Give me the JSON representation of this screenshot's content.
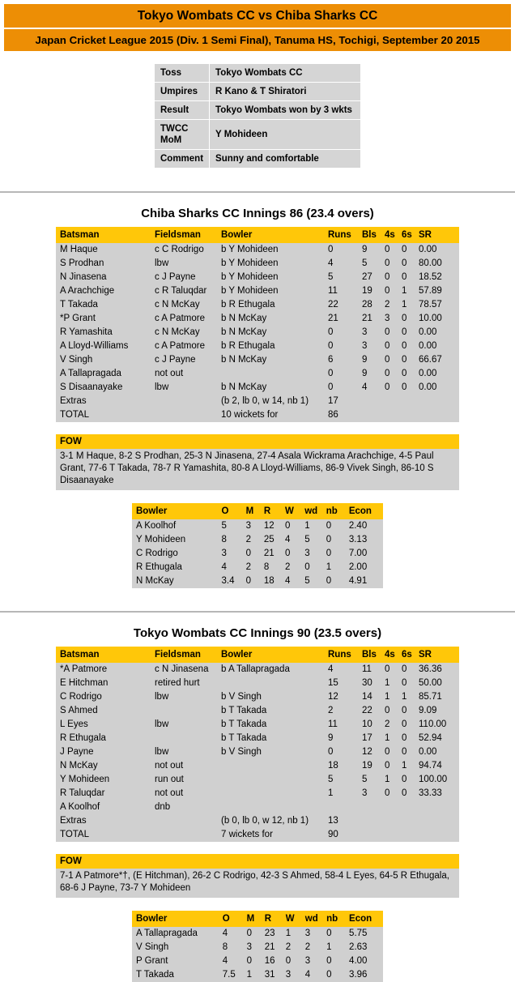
{
  "header": {
    "title": "Tokyo Wombats CC vs Chiba Sharks CC",
    "subtitle": "Japan Cricket League 2015 (Div. 1 Semi Final), Tanuma HS, Tochigi, September 20 2015",
    "colors": {
      "banner_bg": "#ED8E05",
      "table_header": "#FFC709",
      "row_bg": "#d0d0d0"
    }
  },
  "match_info": {
    "rows": [
      {
        "label": "Toss",
        "value": "Tokyo Wombats CC"
      },
      {
        "label": "Umpires",
        "value": "R Kano & T Shiratori"
      },
      {
        "label": "Result",
        "value": "Tokyo Wombats won by 3 wkts"
      },
      {
        "label": "TWCC MoM",
        "value": "Y Mohideen"
      },
      {
        "label": "Comment",
        "value": "Sunny and comfortable"
      }
    ]
  },
  "innings": [
    {
      "title": "Chiba Sharks CC Innings 86 (23.4 overs)",
      "batting_headers": [
        "Batsman",
        "Fieldsman",
        "Bowler",
        "Runs",
        "Bls",
        "4s",
        "6s",
        "SR"
      ],
      "batting_rows": [
        {
          "batsman": "M Haque",
          "fieldsman": "c C Rodrigo",
          "bowler": "b Y Mohideen",
          "runs": "0",
          "bls": "9",
          "fours": "0",
          "sixes": "0",
          "sr": "0.00"
        },
        {
          "batsman": "S Prodhan",
          "fieldsman": "lbw",
          "bowler": "b Y Mohideen",
          "runs": "4",
          "bls": "5",
          "fours": "0",
          "sixes": "0",
          "sr": "80.00"
        },
        {
          "batsman": "N Jinasena",
          "fieldsman": "c J Payne",
          "bowler": "b Y Mohideen",
          "runs": "5",
          "bls": "27",
          "fours": "0",
          "sixes": "0",
          "sr": "18.52"
        },
        {
          "batsman": "A Arachchige",
          "fieldsman": "c R Taluqdar",
          "bowler": "b Y Mohideen",
          "runs": "11",
          "bls": "19",
          "fours": "0",
          "sixes": "1",
          "sr": "57.89"
        },
        {
          "batsman": "T Takada",
          "fieldsman": "c N McKay",
          "bowler": "b R Ethugala",
          "runs": "22",
          "bls": "28",
          "fours": "2",
          "sixes": "1",
          "sr": "78.57"
        },
        {
          "batsman": "*P Grant",
          "fieldsman": "c A Patmore",
          "bowler": "b N McKay",
          "runs": "21",
          "bls": "21",
          "fours": "3",
          "sixes": "0",
          "sr": "10.00"
        },
        {
          "batsman": "R Yamashita",
          "fieldsman": "c N McKay",
          "bowler": "b N McKay",
          "runs": "0",
          "bls": "3",
          "fours": "0",
          "sixes": "0",
          "sr": "0.00"
        },
        {
          "batsman": "A Lloyd-Williams",
          "fieldsman": "c A Patmore",
          "bowler": "b R Ethugala",
          "runs": "0",
          "bls": "3",
          "fours": "0",
          "sixes": "0",
          "sr": "0.00"
        },
        {
          "batsman": "V Singh",
          "fieldsman": "c J Payne",
          "bowler": "b N McKay",
          "runs": "6",
          "bls": "9",
          "fours": "0",
          "sixes": "0",
          "sr": "66.67"
        },
        {
          "batsman": "A Tallapragada",
          "fieldsman": "not out",
          "bowler": "",
          "runs": "0",
          "bls": "9",
          "fours": "0",
          "sixes": "0",
          "sr": "0.00"
        },
        {
          "batsman": "S Disaanayake",
          "fieldsman": "lbw",
          "bowler": "b N McKay",
          "runs": "0",
          "bls": "4",
          "fours": "0",
          "sixes": "0",
          "sr": "0.00"
        },
        {
          "batsman": "Extras",
          "fieldsman": "",
          "bowler": "(b 2, lb 0, w 14, nb 1)",
          "runs": "17",
          "bls": "",
          "fours": "",
          "sixes": "",
          "sr": ""
        },
        {
          "batsman": "TOTAL",
          "fieldsman": "",
          "bowler": "10 wickets for",
          "runs": "86",
          "bls": "",
          "fours": "",
          "sixes": "",
          "sr": ""
        }
      ],
      "fow_label": "FOW",
      "fow_text": "3-1 M Haque, 8-2 S Prodhan, 25-3 N Jinasena, 27-4 Asala Wickrama Arachchige, 4-5 Paul Grant, 77-6 T Takada, 78-7 R Yamashita, 80-8 A Lloyd-Williams, 86-9 Vivek Singh, 86-10 S Disaanayake",
      "bowling_headers": [
        "Bowler",
        "O",
        "M",
        "R",
        "W",
        "wd",
        "nb",
        "Econ"
      ],
      "bowling_rows": [
        {
          "bowler": "A Koolhof",
          "o": "5",
          "m": "3",
          "r": "12",
          "w": "0",
          "wd": "1",
          "nb": "0",
          "econ": "2.40"
        },
        {
          "bowler": "Y Mohideen",
          "o": "8",
          "m": "2",
          "r": "25",
          "w": "4",
          "wd": "5",
          "nb": "0",
          "econ": "3.13"
        },
        {
          "bowler": "C Rodrigo",
          "o": "3",
          "m": "0",
          "r": "21",
          "w": "0",
          "wd": "3",
          "nb": "0",
          "econ": "7.00"
        },
        {
          "bowler": "R Ethugala",
          "o": "4",
          "m": "2",
          "r": "8",
          "w": "2",
          "wd": "0",
          "nb": "1",
          "econ": "2.00"
        },
        {
          "bowler": "N McKay",
          "o": "3.4",
          "m": "0",
          "r": "18",
          "w": "4",
          "wd": "5",
          "nb": "0",
          "econ": "4.91"
        }
      ]
    },
    {
      "title": "Tokyo Wombats CC Innings 90 (23.5 overs)",
      "batting_headers": [
        "Batsman",
        "Fieldsman",
        "Bowler",
        "Runs",
        "Bls",
        "4s",
        "6s",
        "SR"
      ],
      "batting_rows": [
        {
          "batsman": "*A Patmore",
          "fieldsman": "c N Jinasena",
          "bowler": "b A Tallapragada",
          "runs": "4",
          "bls": "11",
          "fours": "0",
          "sixes": "0",
          "sr": "36.36"
        },
        {
          "batsman": "E Hitchman",
          "fieldsman": "retired hurt",
          "bowler": "",
          "runs": "15",
          "bls": "30",
          "fours": "1",
          "sixes": "0",
          "sr": "50.00"
        },
        {
          "batsman": "C Rodrigo",
          "fieldsman": "lbw",
          "bowler": "b V Singh",
          "runs": "12",
          "bls": "14",
          "fours": "1",
          "sixes": "1",
          "sr": "85.71"
        },
        {
          "batsman": "S Ahmed",
          "fieldsman": "",
          "bowler": "b T Takada",
          "runs": "2",
          "bls": "22",
          "fours": "0",
          "sixes": "0",
          "sr": "9.09"
        },
        {
          "batsman": "L Eyes",
          "fieldsman": "lbw",
          "bowler": "b T Takada",
          "runs": "11",
          "bls": "10",
          "fours": "2",
          "sixes": "0",
          "sr": "110.00"
        },
        {
          "batsman": "R Ethugala",
          "fieldsman": "",
          "bowler": "b T Takada",
          "runs": "9",
          "bls": "17",
          "fours": "1",
          "sixes": "0",
          "sr": "52.94"
        },
        {
          "batsman": "J Payne",
          "fieldsman": "lbw",
          "bowler": "b V Singh",
          "runs": "0",
          "bls": "12",
          "fours": "0",
          "sixes": "0",
          "sr": "0.00"
        },
        {
          "batsman": "N McKay",
          "fieldsman": "not out",
          "bowler": "",
          "runs": "18",
          "bls": "19",
          "fours": "0",
          "sixes": "1",
          "sr": "94.74"
        },
        {
          "batsman": "Y Mohideen",
          "fieldsman": "run out",
          "bowler": "",
          "runs": "5",
          "bls": "5",
          "fours": "1",
          "sixes": "0",
          "sr": "100.00"
        },
        {
          "batsman": "R Taluqdar",
          "fieldsman": "not out",
          "bowler": "",
          "runs": "1",
          "bls": "3",
          "fours": "0",
          "sixes": "0",
          "sr": "33.33"
        },
        {
          "batsman": "A Koolhof",
          "fieldsman": "dnb",
          "bowler": "",
          "runs": "",
          "bls": "",
          "fours": "",
          "sixes": "",
          "sr": ""
        },
        {
          "batsman": "Extras",
          "fieldsman": "",
          "bowler": "(b 0, lb 0, w 12, nb 1)",
          "runs": "13",
          "bls": "",
          "fours": "",
          "sixes": "",
          "sr": ""
        },
        {
          "batsman": "TOTAL",
          "fieldsman": "",
          "bowler": "7 wickets for",
          "runs": "90",
          "bls": "",
          "fours": "",
          "sixes": "",
          "sr": ""
        }
      ],
      "fow_label": "FOW",
      "fow_text": "7-1 A Patmore*†, (E Hitchman), 26-2 C Rodrigo, 42-3 S Ahmed, 58-4 L Eyes, 64-5 R Ethugala, 68-6 J Payne, 73-7 Y Mohideen",
      "bowling_headers": [
        "Bowler",
        "O",
        "M",
        "R",
        "W",
        "wd",
        "nb",
        "Econ"
      ],
      "bowling_rows": [
        {
          "bowler": "A Tallapragada",
          "o": "4",
          "m": "0",
          "r": "23",
          "w": "1",
          "wd": "3",
          "nb": "0",
          "econ": "5.75"
        },
        {
          "bowler": "V Singh",
          "o": "8",
          "m": "3",
          "r": "21",
          "w": "2",
          "wd": "2",
          "nb": "1",
          "econ": "2.63"
        },
        {
          "bowler": "P Grant",
          "o": "4",
          "m": "0",
          "r": "16",
          "w": "0",
          "wd": "3",
          "nb": "0",
          "econ": "4.00"
        },
        {
          "bowler": "T Takada",
          "o": "7.5",
          "m": "1",
          "r": "31",
          "w": "3",
          "wd": "4",
          "nb": "0",
          "econ": "3.96"
        }
      ]
    }
  ]
}
